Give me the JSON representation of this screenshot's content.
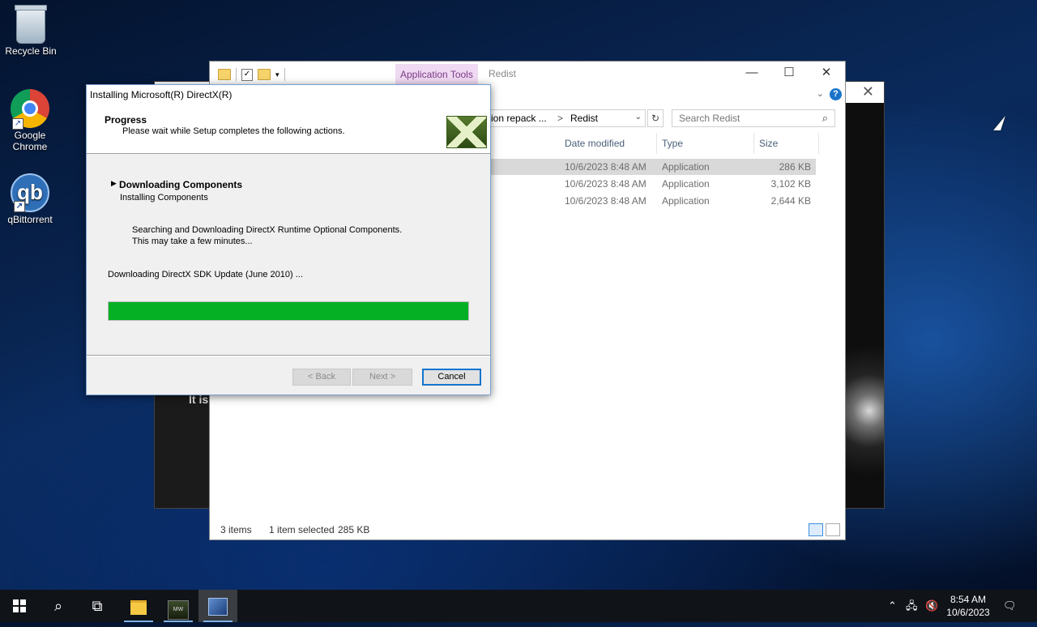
{
  "desktop": {
    "icons": [
      {
        "label": "Recycle Bin",
        "icon": "recycle-bin-icon"
      },
      {
        "label": "Google Chrome",
        "icon": "chrome-icon"
      },
      {
        "label": "qBittorrent",
        "icon": "qbittorrent-icon",
        "glyph": "qb"
      }
    ],
    "background_window_text": "It is"
  },
  "explorer": {
    "context_tab": "Application Tools",
    "title": "Redist",
    "address": {
      "segment1": "ition repack ...",
      "separator": ">",
      "segment2": "Redist"
    },
    "search_placeholder": "Search Redist",
    "columns": [
      "Date modified",
      "Type",
      "Size"
    ],
    "rows": [
      {
        "date": "10/6/2023 8:48 AM",
        "type": "Application",
        "size": "286 KB",
        "selected": true
      },
      {
        "date": "10/6/2023 8:48 AM",
        "type": "Application",
        "size": "3,102 KB",
        "selected": false
      },
      {
        "date": "10/6/2023 8:48 AM",
        "type": "Application",
        "size": "2,644 KB",
        "selected": false
      }
    ],
    "status": {
      "items": "3 items",
      "selected": "1 item selected",
      "size": "285 KB"
    }
  },
  "installer": {
    "title": "Installing Microsoft(R) DirectX(R)",
    "header_title": "Progress",
    "header_subtitle": "Please wait while Setup completes the following actions.",
    "step_title": "Downloading Components",
    "step_subtitle": "Installing Components",
    "message_line1": "Searching and Downloading DirectX Runtime Optional Components.",
    "message_line2": "This may take a few minutes...",
    "download_status": "Downloading DirectX SDK Update (June 2010) ...",
    "progress": 1.0,
    "progress_color": "#06b025",
    "buttons": {
      "back": "< Back",
      "next": "Next >",
      "cancel": "Cancel"
    }
  },
  "taskbar": {
    "time": "8:54 AM",
    "date": "10/6/2023",
    "game_label": "MW"
  }
}
